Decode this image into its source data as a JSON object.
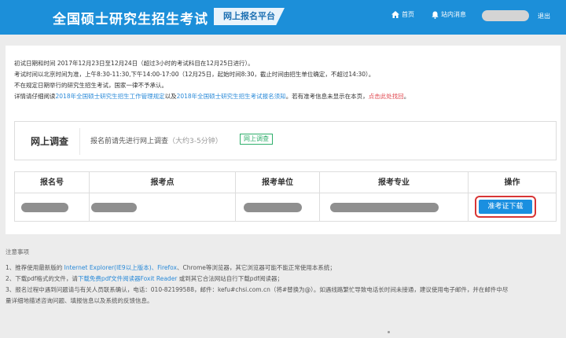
{
  "header": {
    "site_title": "全国硕士研究生招生考试",
    "platform_badge": "网上报名平台",
    "home_label": "首页",
    "messages_label": "站内消息",
    "logout_label": "退出",
    "icons": {
      "home": "home-icon",
      "messages": "bell-icon"
    },
    "bg_color": "#1c8fd9"
  },
  "info": {
    "line1": "初试日期和时间 2017年12月23日至12月24日（超过3小时的考试科目在12月25日进行）。",
    "line2": "考试时间以北京时间为准，上午8:30-11:30,下午14:00-17:00（12月25日，起始时间8:30，截止时间由招生单位确定，不超过14:30）。",
    "line3": "不在规定日期举行的研究生招生考试，国家一律不予承认。",
    "line4_prefix": "详情请仔细阅读",
    "line4_link1": "2018年全国硕士研究生招生工作管理规定",
    "line4_mid": "以及",
    "line4_link2": "2018年全国硕士研究生招生考试报名须知",
    "line4_suffix": "。若有准考信息未显示在本页，",
    "line4_link3": "点击此处找回",
    "line4_end": "。"
  },
  "survey": {
    "title": "网上调查",
    "text": "报名前请先进行网上调查",
    "duration": "（大约3-5分钟）",
    "button": "网上调查"
  },
  "table": {
    "headers": [
      "报名号",
      "报考点",
      "报考单位",
      "报考专业",
      "操作"
    ],
    "action_button": "准考证下载"
  },
  "notes": {
    "heading": "注意事项",
    "item1_prefix": "1、推荐使用最新版的 ",
    "item1_link": "Internet Explorer(IE9以上版本)、Firefox",
    "item1_suffix": "、Chrome等浏览器，其它浏览器可能不能正常使用本系统；",
    "item2_prefix": "2、下载pdf格式的文件，请",
    "item2_link": "下载免费pdf文件阅读器Foxit Reader",
    "item2_suffix": " 或到其它合法网站自行下载pdf阅读器；",
    "item3": "3、报名过程中遇到问题请与有关人员联系确认，电话：010-82199588，邮件：kefu#chsi.com.cn（将#替换为@）。如遇线路繁忙导致电话长时间未接通，建议使用电子邮件，并在邮件中尽",
    "item3_cont": "量详细地描述咨询问题、填报信息以及系统的反馈信息。"
  }
}
